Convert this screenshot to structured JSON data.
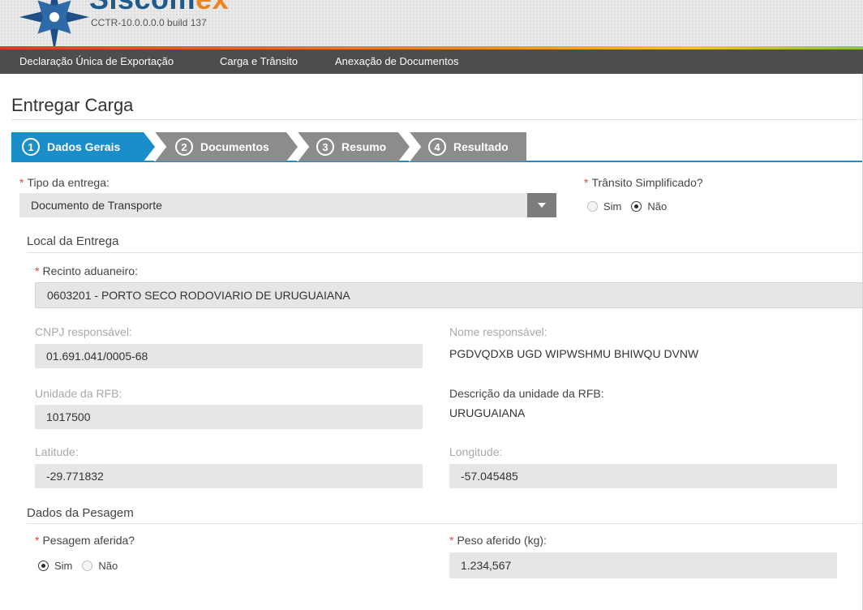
{
  "header": {
    "logo_main": "Siscom",
    "logo_accent": "ex",
    "build": "CCTR-10.0.0.0.0 build 137"
  },
  "menu": {
    "items": [
      "Declaração Única de Exportação",
      "Carga e Trânsito",
      "Anexação de Documentos"
    ]
  },
  "page": {
    "title": "Entregar Carga"
  },
  "wizard": {
    "steps": [
      {
        "num": "1",
        "label": "Dados Gerais",
        "active": true
      },
      {
        "num": "2",
        "label": "Documentos",
        "active": false
      },
      {
        "num": "3",
        "label": "Resumo",
        "active": false
      },
      {
        "num": "4",
        "label": "Resultado",
        "active": false
      }
    ]
  },
  "form": {
    "tipo_entrega": {
      "label": "Tipo da entrega:",
      "value": "Documento de Transporte"
    },
    "transito": {
      "label": "Trânsito Simplificado?",
      "options": [
        "Sim",
        "Não"
      ],
      "selected": "Não"
    },
    "local_section": "Local da Entrega",
    "recinto": {
      "label": "Recinto aduaneiro:",
      "value": "0603201 - PORTO SECO RODOVIARIO DE URUGUAIANA"
    },
    "cnpj": {
      "label": "CNPJ responsável:",
      "value": "01.691.041/0005-68"
    },
    "nome": {
      "label": "Nome responsável:",
      "value": "PGDVQDXB UGD WIPWSHMU BHIWQU DVNW"
    },
    "unidade": {
      "label": "Unidade da RFB:",
      "value": "1017500"
    },
    "descricao": {
      "label": "Descrição da unidade da RFB:",
      "value": "URUGUAIANA"
    },
    "latitude": {
      "label": "Latitude:",
      "value": "-29.771832"
    },
    "longitude": {
      "label": "Longitude:",
      "value": "-57.045485"
    },
    "pesagem_section": "Dados da Pesagem",
    "pesagem": {
      "label": "Pesagem aferida?",
      "options": [
        "Sim",
        "Não"
      ],
      "selected": "Sim"
    },
    "peso": {
      "label": "Peso aferido (kg):",
      "value": "1.234,567"
    }
  },
  "colors": {
    "accent": "#1a8ec9",
    "inactive_step": "#8c8c8c",
    "menu_bg": "#4d4d4d",
    "required": "#e0463a"
  }
}
